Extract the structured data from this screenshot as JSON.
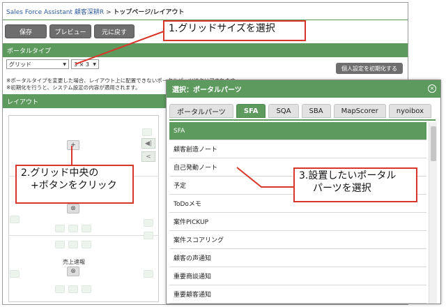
{
  "breadcrumb": {
    "app": "Sales Force Assistant 顧客深耕R",
    "separator": " > ",
    "page": "トップページ/レイアウト"
  },
  "toolbar": {
    "save_label": "保存",
    "preview_label": "プレビュー",
    "revert_label": "元に戻す"
  },
  "portal_type": {
    "section_title": "ポータルタイプ",
    "type_value": "グリッド",
    "size_value": "3 × 3",
    "reset_label": "個人設定を初期化する",
    "note_line1": "※ポータルタイプを変更した場合、レイアウト上に配置できないポータルパーツはクリアされます。",
    "note_line2": "※初期化を行うと、システム設定の内容が適用されます。"
  },
  "layout": {
    "section_title": "レイアウト",
    "add_symbol": "+",
    "remove_symbol": "⊗",
    "cell_part_label": "売上速報",
    "side_symbol_1": "◀|",
    "side_symbol_2": "<"
  },
  "dialog": {
    "title": "選択：ポータルパーツ",
    "close_symbol": "×",
    "tabs": [
      "ポータルパーツ",
      "SFA",
      "SQA",
      "SBA",
      "MapScorer",
      "nyoibox"
    ],
    "active_tab": "SFA",
    "list_header": "SFA",
    "items": [
      "顧客創造ノート",
      "自己発動ノート",
      "予定",
      "ToDoメモ",
      "案件PICKUP",
      "案件スコアリング",
      "顧客の声通知",
      "重要商談通知",
      "重要顧客通知"
    ]
  },
  "callouts": {
    "step1": "1.グリッドサイズを選択",
    "step2_line1": "2.グリッド中央の",
    "step2_line2": "+ボタンをクリック",
    "step3_line1": "3.設置したいポータル",
    "step3_line2": "パーツを選択"
  },
  "colors": {
    "accent_green": "#5c9a5e",
    "callout_red": "#d9362a",
    "button_gray": "#6e6e6e"
  }
}
